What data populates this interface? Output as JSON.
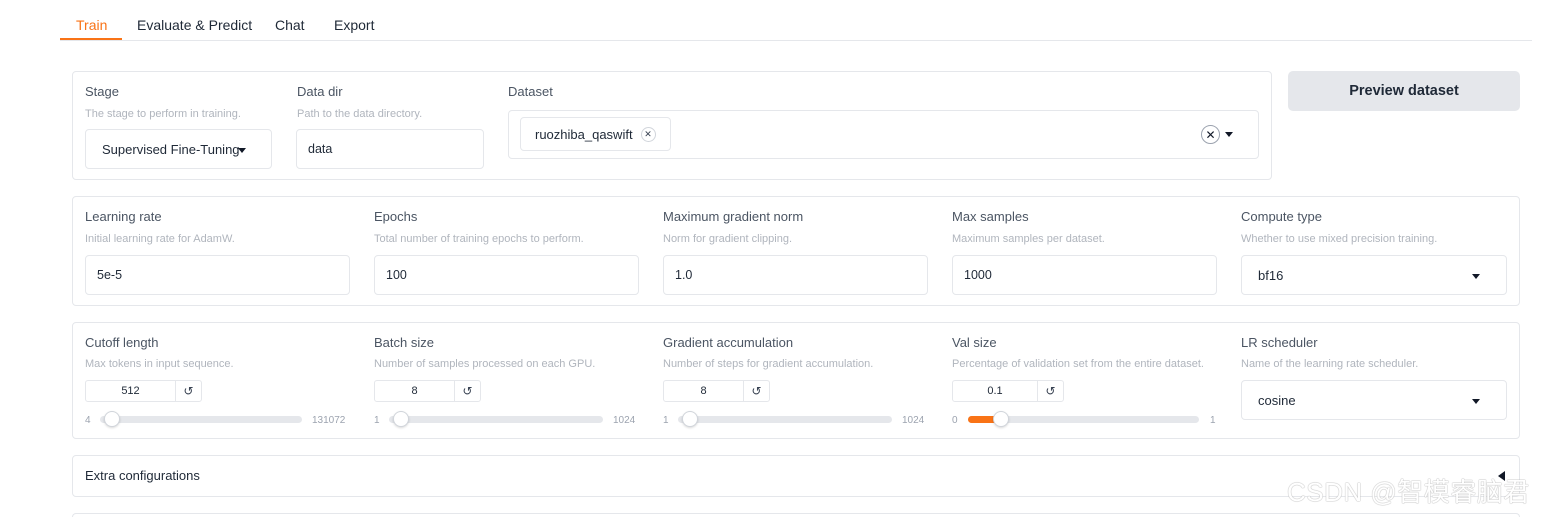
{
  "tabs": [
    {
      "label": "Train",
      "active": true
    },
    {
      "label": "Evaluate & Predict",
      "active": false
    },
    {
      "label": "Chat",
      "active": false
    },
    {
      "label": "Export",
      "active": false
    }
  ],
  "colors": {
    "accent": "#f97316",
    "button_bg": "#e5e7eb"
  },
  "row1": {
    "stage": {
      "label": "Stage",
      "info": "The stage to perform in training.",
      "value": "Supervised Fine-Tuning"
    },
    "data_dir": {
      "label": "Data dir",
      "info": "Path to the data directory.",
      "value": "data"
    },
    "dataset": {
      "label": "Dataset",
      "chips": [
        "ruozhiba_qaswift"
      ]
    },
    "preview_button": "Preview dataset"
  },
  "row2": {
    "learning_rate": {
      "label": "Learning rate",
      "info": "Initial learning rate for AdamW.",
      "value": "5e-5"
    },
    "epochs": {
      "label": "Epochs",
      "info": "Total number of training epochs to perform.",
      "value": "100"
    },
    "max_grad_norm": {
      "label": "Maximum gradient norm",
      "info": "Norm for gradient clipping.",
      "value": "1.0"
    },
    "max_samples": {
      "label": "Max samples",
      "info": "Maximum samples per dataset.",
      "value": "1000"
    },
    "compute_type": {
      "label": "Compute type",
      "info": "Whether to use mixed precision training.",
      "value": "bf16"
    }
  },
  "row3": {
    "cutoff_len": {
      "label": "Cutoff length",
      "info": "Max tokens in input sequence.",
      "value": "512",
      "min": "4",
      "max": "131072",
      "fraction": 0.004
    },
    "batch_size": {
      "label": "Batch size",
      "info": "Number of samples processed on each GPU.",
      "value": "8",
      "min": "1",
      "max": "1024",
      "fraction": 0.007
    },
    "grad_accum": {
      "label": "Gradient accumulation",
      "info": "Number of steps for gradient accumulation.",
      "value": "8",
      "min": "1",
      "max": "1024",
      "fraction": 0.007
    },
    "val_size": {
      "label": "Val size",
      "info": "Percentage of validation set from the entire dataset.",
      "value": "0.1",
      "min": "0",
      "max": "1",
      "fraction": 0.1
    },
    "lr_scheduler": {
      "label": "LR scheduler",
      "info": "Name of the learning rate scheduler.",
      "value": "cosine"
    }
  },
  "extra": {
    "label": "Extra configurations"
  },
  "watermark": "CSDN @智模睿脑君"
}
